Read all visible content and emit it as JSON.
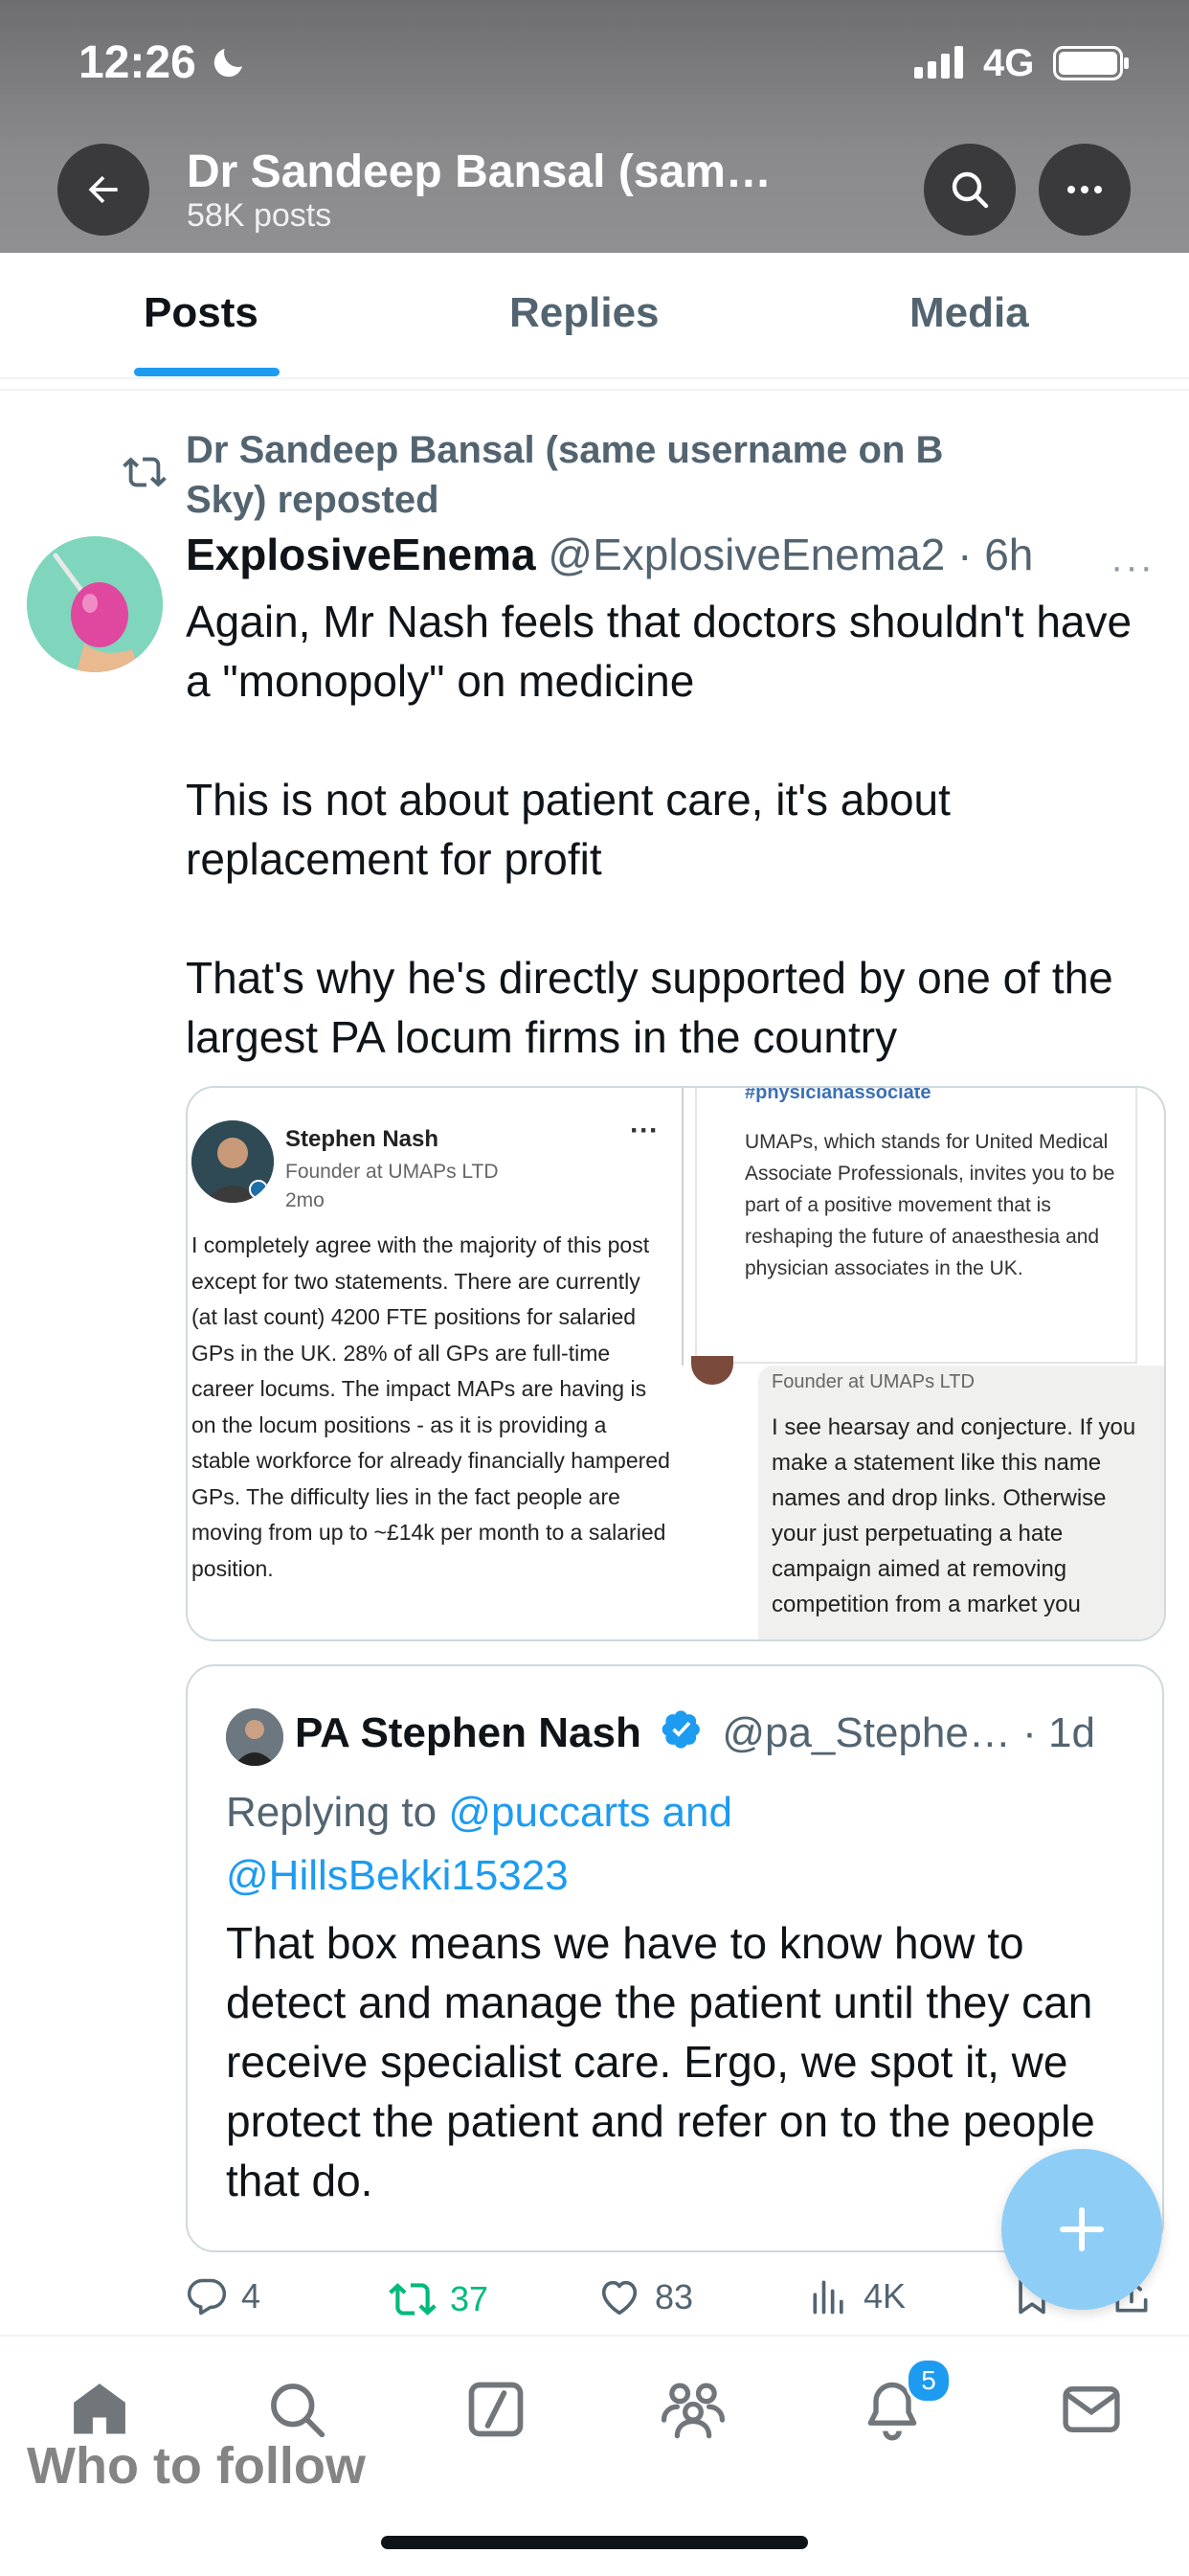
{
  "status_bar": {
    "time": "12:26",
    "network": "4G"
  },
  "header": {
    "profile_name": "Dr Sandeep Bansal (sam…",
    "post_count": "58K posts"
  },
  "tabs": [
    {
      "label": "Posts",
      "active": true
    },
    {
      "label": "Replies",
      "active": false
    },
    {
      "label": "Media",
      "active": false
    }
  ],
  "post": {
    "repost_label": "Dr Sandeep Bansal (same username on B Sky) reposted",
    "author_name": "ExplosiveEnema",
    "author_handle": "@ExplosiveEnema2",
    "separator": "·",
    "time": "6h",
    "more": "···",
    "paragraphs": [
      "Again, Mr Nash feels that doctors shouldn't have a \"monopoly\" on medicine",
      "This is not about patient care, it's about replacement for profit",
      "That's why he's directly supported by one of the largest PA locum firms in the country"
    ],
    "media": {
      "left": {
        "name": "Stephen Nash",
        "subtitle": "Founder at UMAPs LTD",
        "time": "2mo",
        "dots": "···",
        "body": "I completely agree with the majority of this post except for two statements. There are currently (at last count) 4200 FTE positions for salaried GPs in the UK. 28% of all GPs are full-time career locums. The impact MAPs are having is on the locum positions - as it is providing a stable workforce for already financially hampered GPs. The difficulty lies in the fact people are moving from up to ~£14k per month to a salaried position."
      },
      "right_top": {
        "hashtag": "#physicianassociate",
        "text": "UMAPs, which stands for United Medical Associate Professionals, invites you to be part of a positive movement that is reshaping the future of anaesthesia and physician associates in the UK."
      },
      "right_bottom": {
        "subtitle": "Founder at UMAPs LTD",
        "text": "I see hearsay and conjecture. If you make a statement like this name names and drop links. Otherwise your just perpetuating a hate campaign aimed at removing competition from a market you"
      }
    },
    "quote": {
      "name": "PA Stephen Nash",
      "handle": "@pa_Stephe…",
      "separator": "·",
      "time": "1d",
      "replying_prefix": "Replying to",
      "replying_user1": "@puccarts",
      "replying_and": "and",
      "replying_user2": "@HillsBekki15323",
      "text": "That box means we have to know how to detect and manage the patient until they can receive specialist care. Ergo, we spot it, we protect the patient and refer on to the people that do."
    },
    "actions": {
      "replies": "4",
      "reposts": "37",
      "likes": "83",
      "views": "4K"
    }
  },
  "bottom_nav": {
    "notification_count": "5",
    "who_to_follow": "Who to follow"
  },
  "colors": {
    "accent": "#1d9bf0",
    "repost_green": "#00ba7c",
    "secondary_text": "#536471"
  }
}
